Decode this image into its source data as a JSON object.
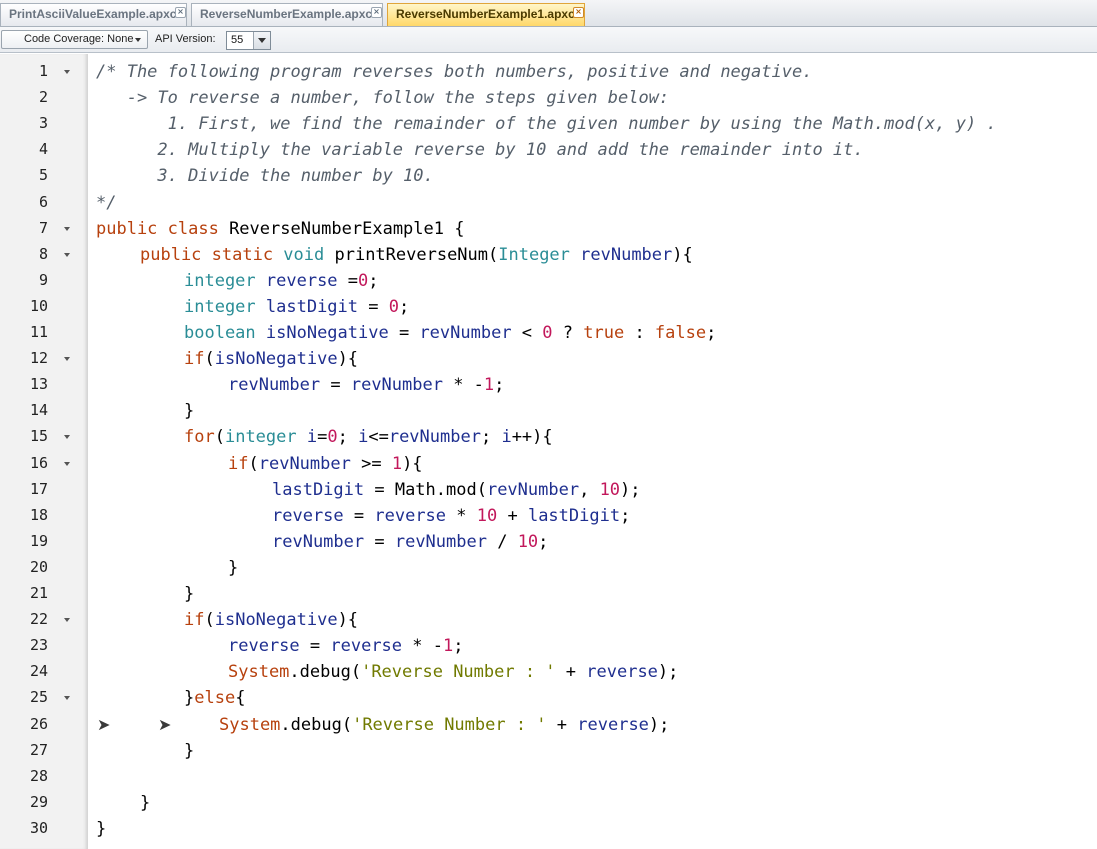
{
  "tabs": [
    {
      "label": "PrintAsciiValueExample.apxc",
      "active": false
    },
    {
      "label": "ReverseNumberExample.apxc",
      "active": false
    },
    {
      "label": "ReverseNumberExample1.apxc",
      "active": true
    }
  ],
  "toolbar": {
    "coverage_label": "Code Coverage: None",
    "api_label": "API Version:",
    "api_value": "55"
  },
  "editor": {
    "current_line_marker": "➤",
    "lines": [
      {
        "n": "1",
        "fold": true,
        "indent": 0,
        "tokens": [
          [
            "cm",
            "/* The following program reverses both numbers, positive and negative."
          ]
        ]
      },
      {
        "n": "2",
        "fold": false,
        "indent": 0,
        "tokens": [
          [
            "cm",
            "   -> To reverse a number, follow the steps given below:"
          ]
        ]
      },
      {
        "n": "3",
        "fold": false,
        "indent": 0,
        "tokens": [
          [
            "cm",
            "       1. First, we find the remainder of the given number by using the Math.mod(x, y) ."
          ]
        ]
      },
      {
        "n": "4",
        "fold": false,
        "indent": 0,
        "tokens": [
          [
            "cm",
            "      2. Multiply the variable reverse by 10 and add the remainder into it."
          ]
        ]
      },
      {
        "n": "5",
        "fold": false,
        "indent": 0,
        "tokens": [
          [
            "cm",
            "      3. Divide the number by 10."
          ]
        ]
      },
      {
        "n": "6",
        "fold": false,
        "indent": 0,
        "tokens": [
          [
            "cm",
            "*/"
          ]
        ]
      },
      {
        "n": "7",
        "fold": true,
        "indent": 0,
        "tokens": [
          [
            "kw",
            "public class "
          ],
          [
            "pl",
            "ReverseNumberExample1 {"
          ]
        ]
      },
      {
        "n": "8",
        "fold": true,
        "indent": 1,
        "tokens": [
          [
            "kw",
            "public static "
          ],
          [
            "ty",
            "void "
          ],
          [
            "pl",
            "printReverseNum("
          ],
          [
            "ty",
            "Integer "
          ],
          [
            "id",
            "revNumber"
          ],
          [
            "pl",
            "){"
          ]
        ]
      },
      {
        "n": "9",
        "fold": false,
        "indent": 2,
        "tokens": [
          [
            "ty",
            "integer "
          ],
          [
            "id",
            "reverse "
          ],
          [
            "pl",
            "="
          ],
          [
            "num",
            "0"
          ],
          [
            "pl",
            ";"
          ]
        ]
      },
      {
        "n": "10",
        "fold": false,
        "indent": 2,
        "tokens": [
          [
            "ty",
            "integer "
          ],
          [
            "id",
            "lastDigit "
          ],
          [
            "pl",
            "= "
          ],
          [
            "num",
            "0"
          ],
          [
            "pl",
            ";"
          ]
        ]
      },
      {
        "n": "11",
        "fold": false,
        "indent": 2,
        "tokens": [
          [
            "ty",
            "boolean "
          ],
          [
            "id",
            "isNoNegative "
          ],
          [
            "pl",
            "= "
          ],
          [
            "id",
            "revNumber "
          ],
          [
            "pl",
            "< "
          ],
          [
            "num",
            "0 "
          ],
          [
            "pl",
            "? "
          ],
          [
            "kw",
            "true "
          ],
          [
            "pl",
            ": "
          ],
          [
            "kw",
            "false"
          ],
          [
            "pl",
            ";"
          ]
        ]
      },
      {
        "n": "12",
        "fold": true,
        "indent": 2,
        "tokens": [
          [
            "kw",
            "if"
          ],
          [
            "pl",
            "("
          ],
          [
            "id",
            "isNoNegative"
          ],
          [
            "pl",
            "){"
          ]
        ]
      },
      {
        "n": "13",
        "fold": false,
        "indent": 3,
        "tokens": [
          [
            "id",
            "revNumber "
          ],
          [
            "pl",
            "= "
          ],
          [
            "id",
            "revNumber "
          ],
          [
            "pl",
            "* -"
          ],
          [
            "num",
            "1"
          ],
          [
            "pl",
            ";"
          ]
        ]
      },
      {
        "n": "14",
        "fold": false,
        "indent": 2,
        "tokens": [
          [
            "pl",
            "}"
          ]
        ]
      },
      {
        "n": "15",
        "fold": true,
        "indent": 2,
        "tokens": [
          [
            "kw",
            "for"
          ],
          [
            "pl",
            "("
          ],
          [
            "ty",
            "integer "
          ],
          [
            "id",
            "i"
          ],
          [
            "pl",
            "="
          ],
          [
            "num",
            "0"
          ],
          [
            "pl",
            "; "
          ],
          [
            "id",
            "i"
          ],
          [
            "pl",
            "<="
          ],
          [
            "id",
            "revNumber"
          ],
          [
            "pl",
            "; "
          ],
          [
            "id",
            "i"
          ],
          [
            "pl",
            "++){"
          ]
        ]
      },
      {
        "n": "16",
        "fold": true,
        "indent": 3,
        "tokens": [
          [
            "kw",
            "if"
          ],
          [
            "pl",
            "("
          ],
          [
            "id",
            "revNumber "
          ],
          [
            "pl",
            ">= "
          ],
          [
            "num",
            "1"
          ],
          [
            "pl",
            "){"
          ]
        ]
      },
      {
        "n": "17",
        "fold": false,
        "indent": 4,
        "tokens": [
          [
            "id",
            "lastDigit "
          ],
          [
            "pl",
            "= Math.mod("
          ],
          [
            "id",
            "revNumber"
          ],
          [
            "pl",
            ", "
          ],
          [
            "num",
            "10"
          ],
          [
            "pl",
            ");"
          ]
        ]
      },
      {
        "n": "18",
        "fold": false,
        "indent": 4,
        "tokens": [
          [
            "id",
            "reverse "
          ],
          [
            "pl",
            "= "
          ],
          [
            "id",
            "reverse "
          ],
          [
            "pl",
            "* "
          ],
          [
            "num",
            "10 "
          ],
          [
            "pl",
            "+ "
          ],
          [
            "id",
            "lastDigit"
          ],
          [
            "pl",
            ";"
          ]
        ]
      },
      {
        "n": "19",
        "fold": false,
        "indent": 4,
        "tokens": [
          [
            "id",
            "revNumber "
          ],
          [
            "pl",
            "= "
          ],
          [
            "id",
            "revNumber "
          ],
          [
            "pl",
            "/ "
          ],
          [
            "num",
            "10"
          ],
          [
            "pl",
            ";"
          ]
        ]
      },
      {
        "n": "20",
        "fold": false,
        "indent": 3,
        "tokens": [
          [
            "pl",
            "}"
          ]
        ]
      },
      {
        "n": "21",
        "fold": false,
        "indent": 2,
        "tokens": [
          [
            "pl",
            "}"
          ]
        ]
      },
      {
        "n": "22",
        "fold": true,
        "indent": 2,
        "tokens": [
          [
            "kw",
            "if"
          ],
          [
            "pl",
            "("
          ],
          [
            "id",
            "isNoNegative"
          ],
          [
            "pl",
            "){"
          ]
        ]
      },
      {
        "n": "23",
        "fold": false,
        "indent": 3,
        "tokens": [
          [
            "id",
            "reverse "
          ],
          [
            "pl",
            "= "
          ],
          [
            "id",
            "reverse "
          ],
          [
            "pl",
            "* -"
          ],
          [
            "num",
            "1"
          ],
          [
            "pl",
            ";"
          ]
        ]
      },
      {
        "n": "24",
        "fold": false,
        "indent": 3,
        "tokens": [
          [
            "kw",
            "System"
          ],
          [
            "pl",
            ".debug("
          ],
          [
            "str",
            "'Reverse Number : '"
          ],
          [
            "pl",
            " + "
          ],
          [
            "id",
            "reverse"
          ],
          [
            "pl",
            ");"
          ]
        ]
      },
      {
        "n": "25",
        "fold": true,
        "indent": 2,
        "tokens": [
          [
            "pl",
            "}"
          ],
          [
            "kw",
            "else"
          ],
          [
            "pl",
            "{"
          ]
        ]
      },
      {
        "n": "26",
        "fold": false,
        "indent": 3,
        "marker": true,
        "tokens": [
          [
            "kw",
            "System"
          ],
          [
            "pl",
            ".debug("
          ],
          [
            "str",
            "'Reverse Number : '"
          ],
          [
            "pl",
            " + "
          ],
          [
            "id",
            "reverse"
          ],
          [
            "pl",
            ");"
          ]
        ]
      },
      {
        "n": "27",
        "fold": false,
        "indent": 2,
        "tokens": [
          [
            "pl",
            "}"
          ]
        ]
      },
      {
        "n": "28",
        "fold": false,
        "indent": 0,
        "tokens": []
      },
      {
        "n": "29",
        "fold": false,
        "indent": 1,
        "tokens": [
          [
            "pl",
            "}"
          ]
        ]
      },
      {
        "n": "30",
        "fold": false,
        "indent": 0,
        "tokens": [
          [
            "pl",
            "}"
          ]
        ]
      }
    ]
  },
  "colors": {
    "active_tab": "#ffd86a",
    "keyword": "#b7410e",
    "type": "#2a8d96",
    "identifier": "#1f2f8f",
    "number": "#c2185b",
    "string": "#707a00",
    "comment": "#555f6a"
  }
}
